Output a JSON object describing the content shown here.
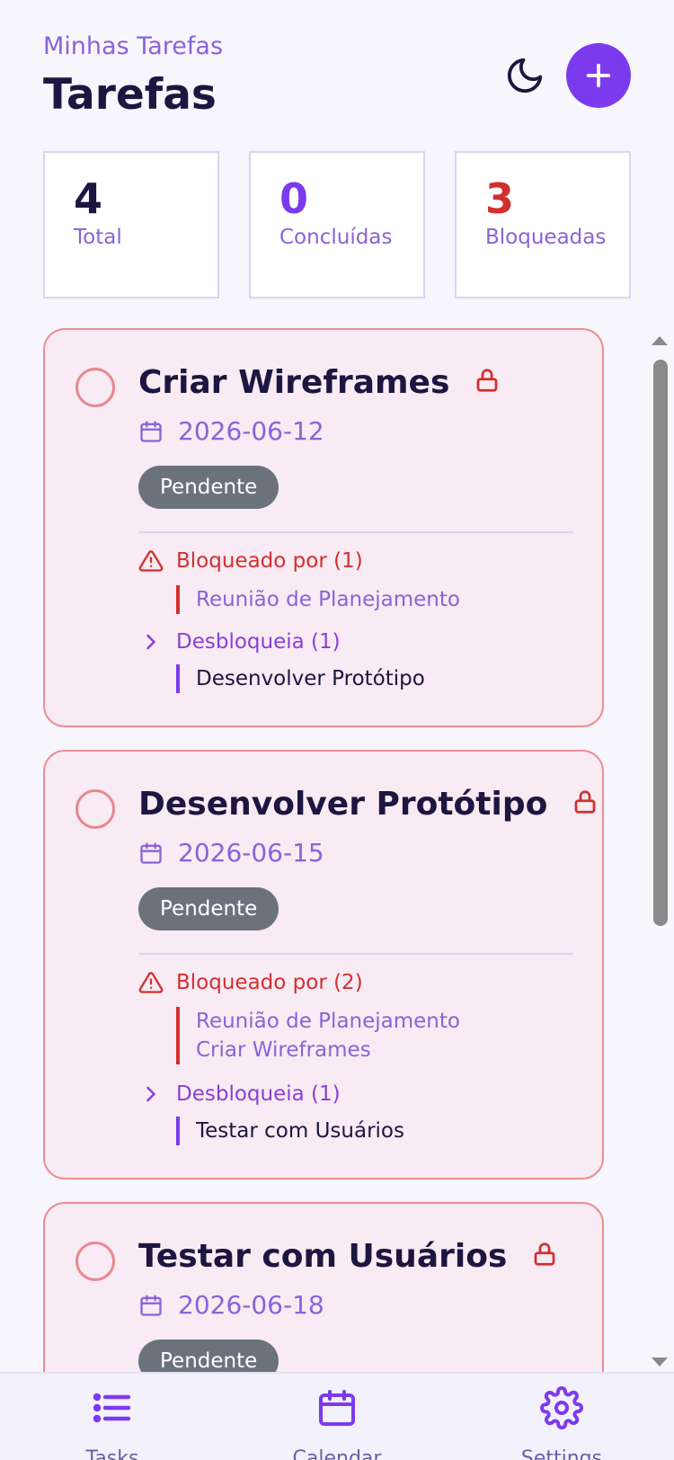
{
  "header": {
    "subtitle": "Minhas Tarefas",
    "title": "Tarefas"
  },
  "stats": [
    {
      "value": "4",
      "label": "Total",
      "color": "#1c1640"
    },
    {
      "value": "0",
      "label": "Concluídas",
      "color": "#7c3aed"
    },
    {
      "value": "3",
      "label": "Bloqueadas",
      "color": "#d32f2f"
    }
  ],
  "tasks": [
    {
      "title": "Criar Wireframes",
      "date": "2026-06-12",
      "status": "Pendente",
      "blocked_by_label": "Bloqueado por (1)",
      "blocked_by": [
        "Reunião de Planejamento"
      ],
      "unblocks_label": "Desbloqueia (1)",
      "unblocks": [
        "Desenvolver Protótipo"
      ]
    },
    {
      "title": "Desenvolver Protótipo",
      "date": "2026-06-15",
      "status": "Pendente",
      "blocked_by_label": "Bloqueado por (2)",
      "blocked_by": [
        "Reunião de Planejamento",
        "Criar Wireframes"
      ],
      "unblocks_label": "Desbloqueia (1)",
      "unblocks": [
        "Testar com Usuários"
      ]
    },
    {
      "title": "Testar com Usuários",
      "date": "2026-06-18",
      "status": "Pendente"
    }
  ],
  "nav": {
    "tasks": "Tasks",
    "calendar": "Calendar",
    "settings": "Settings"
  },
  "colors": {
    "accent": "#7c3aed",
    "danger": "#d32f2f",
    "badge": "#6c727c"
  }
}
